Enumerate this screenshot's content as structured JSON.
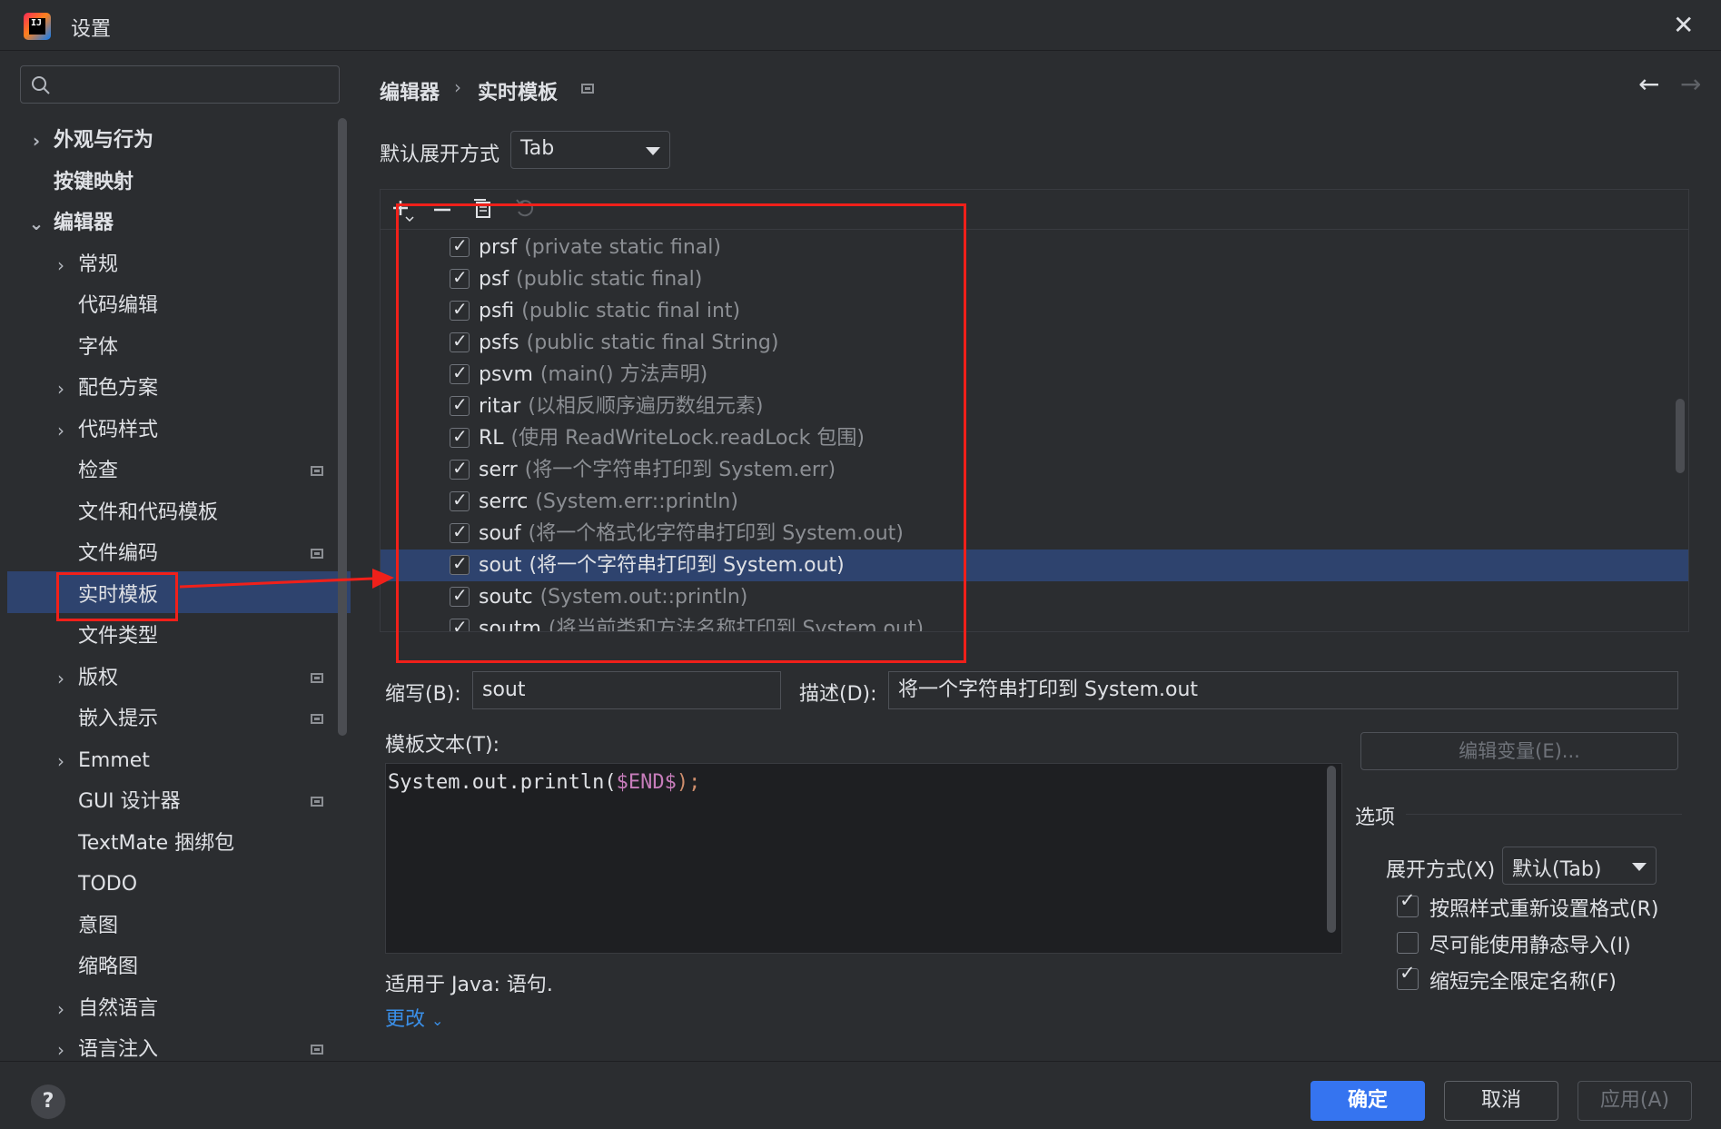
{
  "window": {
    "title": "设置"
  },
  "sidebar": {
    "search_placeholder": "",
    "items": [
      {
        "label": "外观与行为",
        "chevron": "›",
        "bold": true
      },
      {
        "label": "按键映射",
        "chevron": "",
        "bold": true
      },
      {
        "label": "编辑器",
        "chevron": "⌄",
        "bold": true
      },
      {
        "label": "常规",
        "chevron": "›"
      },
      {
        "label": "代码编辑",
        "chevron": ""
      },
      {
        "label": "字体",
        "chevron": ""
      },
      {
        "label": "配色方案",
        "chevron": "›"
      },
      {
        "label": "代码样式",
        "chevron": "›"
      },
      {
        "label": "检查",
        "chevron": "",
        "badge": true
      },
      {
        "label": "文件和代码模板",
        "chevron": ""
      },
      {
        "label": "文件编码",
        "chevron": "",
        "badge": true
      },
      {
        "label": "实时模板",
        "chevron": "",
        "selected": true
      },
      {
        "label": "文件类型",
        "chevron": ""
      },
      {
        "label": "版权",
        "chevron": "›",
        "badge": true
      },
      {
        "label": "嵌入提示",
        "chevron": "",
        "badge": true
      },
      {
        "label": "Emmet",
        "chevron": "›"
      },
      {
        "label": "GUI 设计器",
        "chevron": "",
        "badge": true
      },
      {
        "label": "TextMate 捆绑包",
        "chevron": ""
      },
      {
        "label": "TODO",
        "chevron": ""
      },
      {
        "label": "意图",
        "chevron": ""
      },
      {
        "label": "缩略图",
        "chevron": ""
      },
      {
        "label": "自然语言",
        "chevron": "›"
      },
      {
        "label": "语言注入",
        "chevron": "›",
        "badge": true
      }
    ]
  },
  "breadcrumb": {
    "parent": "编辑器",
    "separator": "›",
    "current": "实时模板"
  },
  "nav": {
    "back": "←",
    "forward": "→"
  },
  "default_expand": {
    "label": "默认展开方式",
    "value": "Tab"
  },
  "templates": [
    {
      "key": "prsf",
      "desc": "(private static final)",
      "checked": true
    },
    {
      "key": "psf",
      "desc": "(public static final)",
      "checked": true
    },
    {
      "key": "psfi",
      "desc": "(public static final int)",
      "checked": true
    },
    {
      "key": "psfs",
      "desc": "(public static final String)",
      "checked": true
    },
    {
      "key": "psvm",
      "desc": "(main() 方法声明)",
      "checked": true
    },
    {
      "key": "ritar",
      "desc": "(以相反顺序遍历数组元素)",
      "checked": true
    },
    {
      "key": "RL",
      "desc": "(使用 ReadWriteLock.readLock 包围)",
      "checked": true
    },
    {
      "key": "serr",
      "desc": "(将一个字符串打印到 System.err)",
      "checked": true
    },
    {
      "key": "serrc",
      "desc": "(System.err::println)",
      "checked": true
    },
    {
      "key": "souf",
      "desc": "(将一个格式化字符串打印到 System.out)",
      "checked": true
    },
    {
      "key": "sout",
      "desc": "(将一个字符串打印到 System.out)",
      "checked": true,
      "selected": true
    },
    {
      "key": "soutc",
      "desc": "(System.out::println)",
      "checked": true
    },
    {
      "key": "soutm",
      "desc": "(将当前类和方法名称打印到 System.out)",
      "checked": true
    }
  ],
  "abbreviation": {
    "label": "缩写(B):",
    "value": "sout"
  },
  "description": {
    "label": "描述(D):",
    "value": "将一个字符串打印到 System.out"
  },
  "template_text": {
    "label": "模板文本(T):",
    "code_prefix": "System.out.println(",
    "code_var": "$END$",
    "code_suffix": ");"
  },
  "edit_variables": "编辑变量(E)...",
  "options": {
    "title": "选项",
    "expand_with_label": "展开方式(X)",
    "expand_with_value": "默认(Tab)",
    "checkboxes": [
      {
        "label": "按照样式重新设置格式(R)",
        "checked": true
      },
      {
        "label": "尽可能使用静态导入(I)",
        "checked": false
      },
      {
        "label": "缩短完全限定名称(F)",
        "checked": true
      }
    ]
  },
  "applicable": "适用于 Java: 语句.",
  "change_link": "更改",
  "footer": {
    "help": "?",
    "ok": "确定",
    "cancel": "取消",
    "apply": "应用(A)"
  },
  "colors": {
    "accent": "#3574f0",
    "selection": "#2e436e",
    "annotation": "#f0201a",
    "link": "#3a8fe8"
  }
}
